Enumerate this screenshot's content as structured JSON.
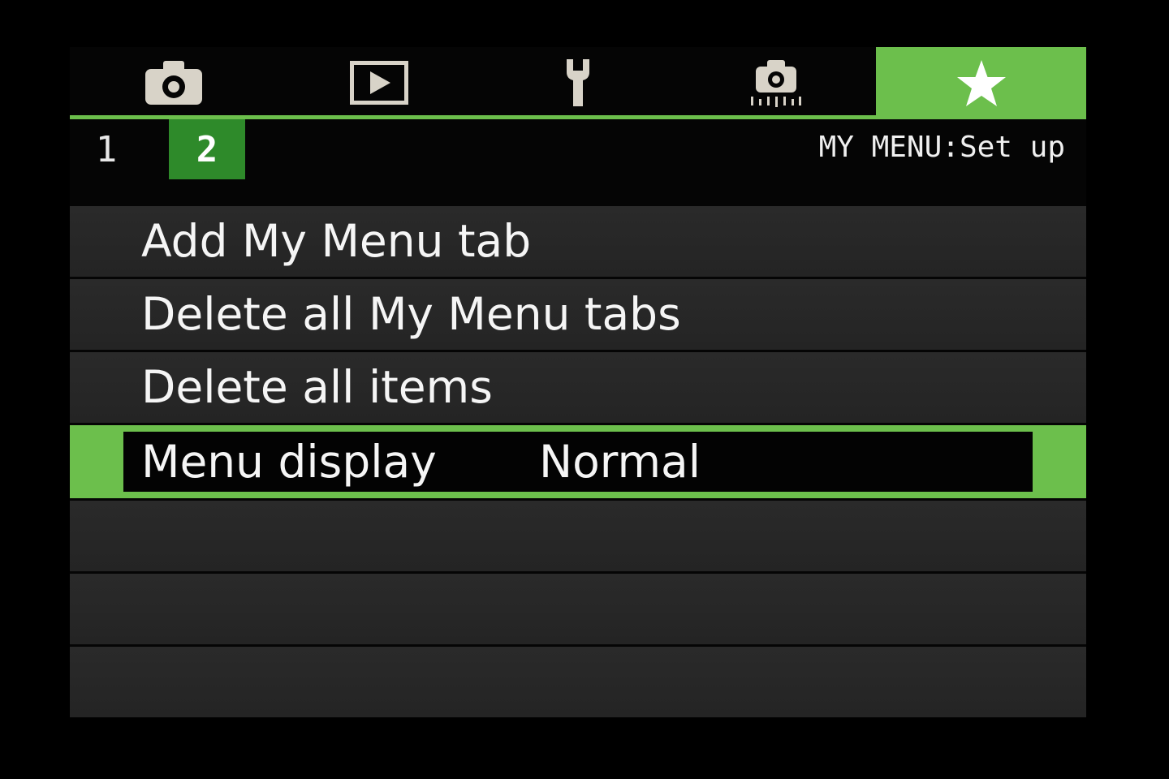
{
  "colors": {
    "accent": "#6cbf4c",
    "subtab_active": "#2e8a2a",
    "icon": "#d8d3c8"
  },
  "tabs": [
    {
      "icon": "camera-icon"
    },
    {
      "icon": "play-icon"
    },
    {
      "icon": "wrench-icon"
    },
    {
      "icon": "custom-functions-icon"
    },
    {
      "icon": "star-icon"
    }
  ],
  "subtabs": [
    "1",
    "2"
  ],
  "header": {
    "title": "MY MENU:Set up"
  },
  "menu": {
    "items": [
      {
        "label": "Add My Menu tab"
      },
      {
        "label": "Delete all My Menu tabs"
      },
      {
        "label": "Delete all items"
      },
      {
        "label": "Menu display",
        "value": "Normal"
      }
    ]
  }
}
